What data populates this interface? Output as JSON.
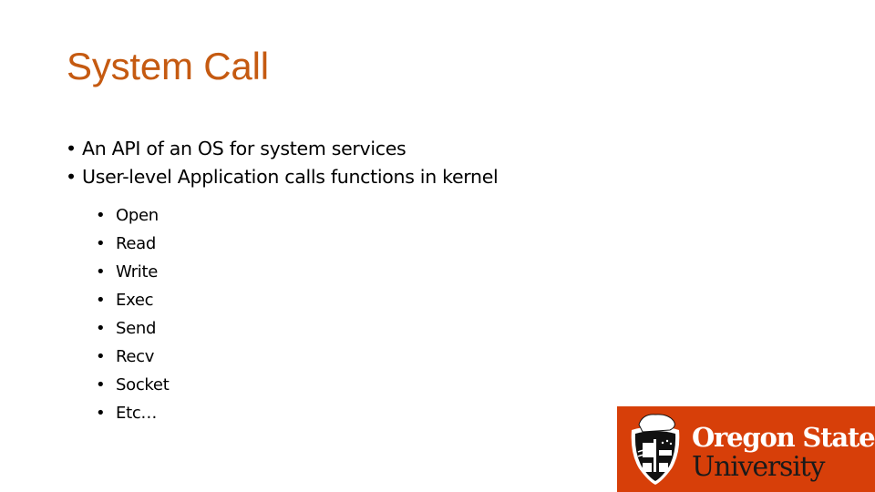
{
  "slide": {
    "title": "System Call",
    "bullets": [
      "An API of an OS for system services",
      "User-level Application calls functions in kernel"
    ],
    "sub_bullets": [
      "Open",
      "Read",
      "Write",
      "Exec",
      "Send",
      "Recv",
      "Socket",
      "Etc…"
    ],
    "bullet_glyph": "•"
  },
  "logo": {
    "line1": "Oregon State",
    "line2": "University",
    "icon": "osu-beaver-shield-icon",
    "background_color": "#d73f09"
  },
  "colors": {
    "title": "#c55a11",
    "text": "#000000"
  }
}
